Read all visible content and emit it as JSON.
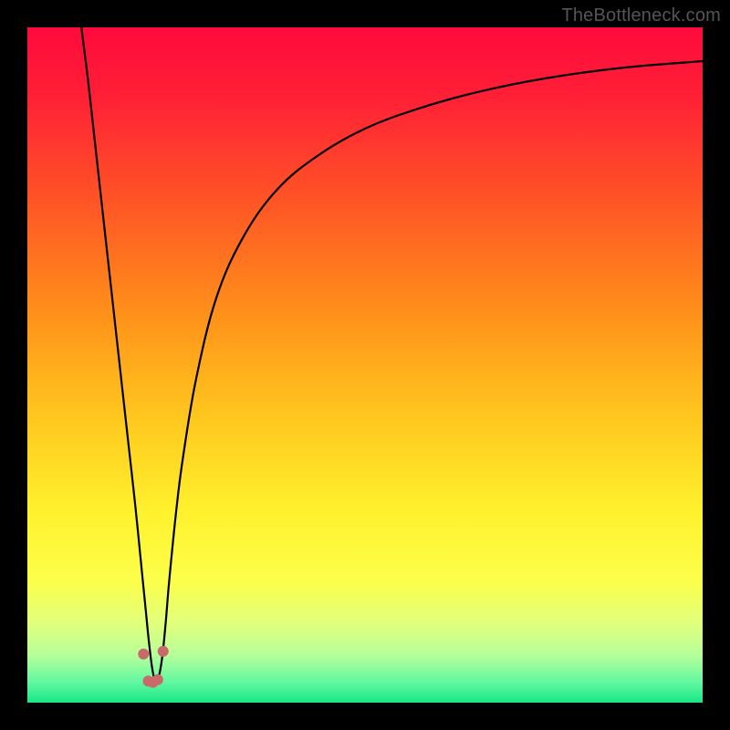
{
  "watermark": "TheBottleneck.com",
  "gradient_stops": [
    {
      "offset": 0.0,
      "color": "#ff0a3c"
    },
    {
      "offset": 0.1,
      "color": "#ff1f36"
    },
    {
      "offset": 0.25,
      "color": "#ff5226"
    },
    {
      "offset": 0.42,
      "color": "#ff8f1a"
    },
    {
      "offset": 0.58,
      "color": "#ffc81e"
    },
    {
      "offset": 0.72,
      "color": "#fff22e"
    },
    {
      "offset": 0.82,
      "color": "#fcff4a"
    },
    {
      "offset": 0.88,
      "color": "#e3ff7a"
    },
    {
      "offset": 0.93,
      "color": "#b6ff9a"
    },
    {
      "offset": 0.97,
      "color": "#61f7a1"
    },
    {
      "offset": 1.0,
      "color": "#17e884"
    }
  ],
  "chart_data": {
    "type": "line",
    "title": "",
    "xlabel": "",
    "ylabel": "",
    "xlim": [
      0,
      100
    ],
    "ylim": [
      0,
      100
    ],
    "grid": false,
    "legend": false,
    "x": [
      8,
      9,
      10,
      11,
      12,
      13,
      14,
      15,
      16,
      17,
      17.5,
      18,
      18.5,
      19,
      19.5,
      20,
      20.5,
      21,
      22,
      23,
      25,
      28,
      32,
      37,
      43,
      50,
      58,
      67,
      77,
      88,
      100
    ],
    "values": [
      100,
      92,
      83,
      74,
      65,
      56,
      47,
      38,
      29,
      19,
      14,
      9,
      5,
      3,
      4,
      7,
      12,
      18,
      28,
      36,
      48,
      60,
      69,
      76,
      81,
      85,
      88,
      90.5,
      92.5,
      94,
      95
    ],
    "markers": {
      "color": "#c86a6a",
      "radius_px": 6,
      "points": [
        {
          "x": 17.2,
          "y": 7.2
        },
        {
          "x": 17.9,
          "y": 3.2
        },
        {
          "x": 18.6,
          "y": 3.0
        },
        {
          "x": 19.3,
          "y": 3.4
        },
        {
          "x": 20.1,
          "y": 7.6
        }
      ]
    }
  }
}
